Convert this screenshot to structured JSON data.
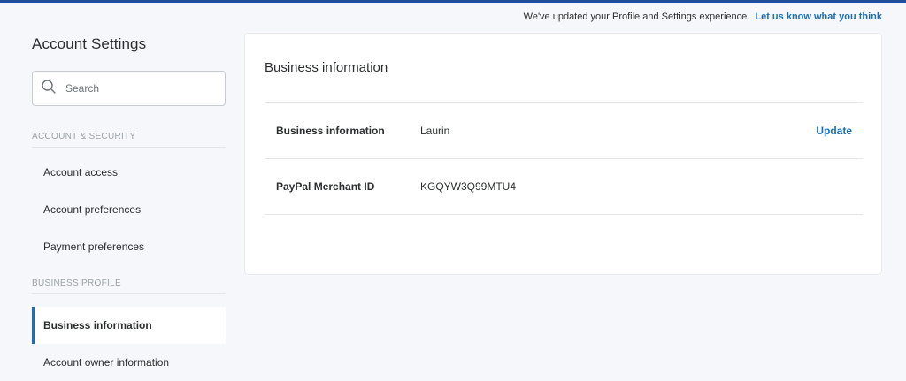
{
  "notice": {
    "text": "We've updated your Profile and Settings experience.",
    "link": "Let us know what you think"
  },
  "sidebar": {
    "title": "Account Settings",
    "search_placeholder": "Search",
    "sections": [
      {
        "label": "ACCOUNT & SECURITY",
        "items": [
          "Account access",
          "Account preferences",
          "Payment preferences"
        ]
      },
      {
        "label": "BUSINESS PROFILE",
        "items": [
          "Business information",
          "Account owner information"
        ]
      }
    ]
  },
  "main": {
    "title": "Business information",
    "rows": [
      {
        "label": "Business information",
        "value": "Laurin",
        "action": "Update"
      },
      {
        "label": "PayPal Merchant ID",
        "value": "KGQYW3Q99MTU4"
      }
    ]
  },
  "colors": {
    "accent": "#1d6fb8",
    "top_bar": "#1f4e9c",
    "background": "#f5f7fa"
  }
}
